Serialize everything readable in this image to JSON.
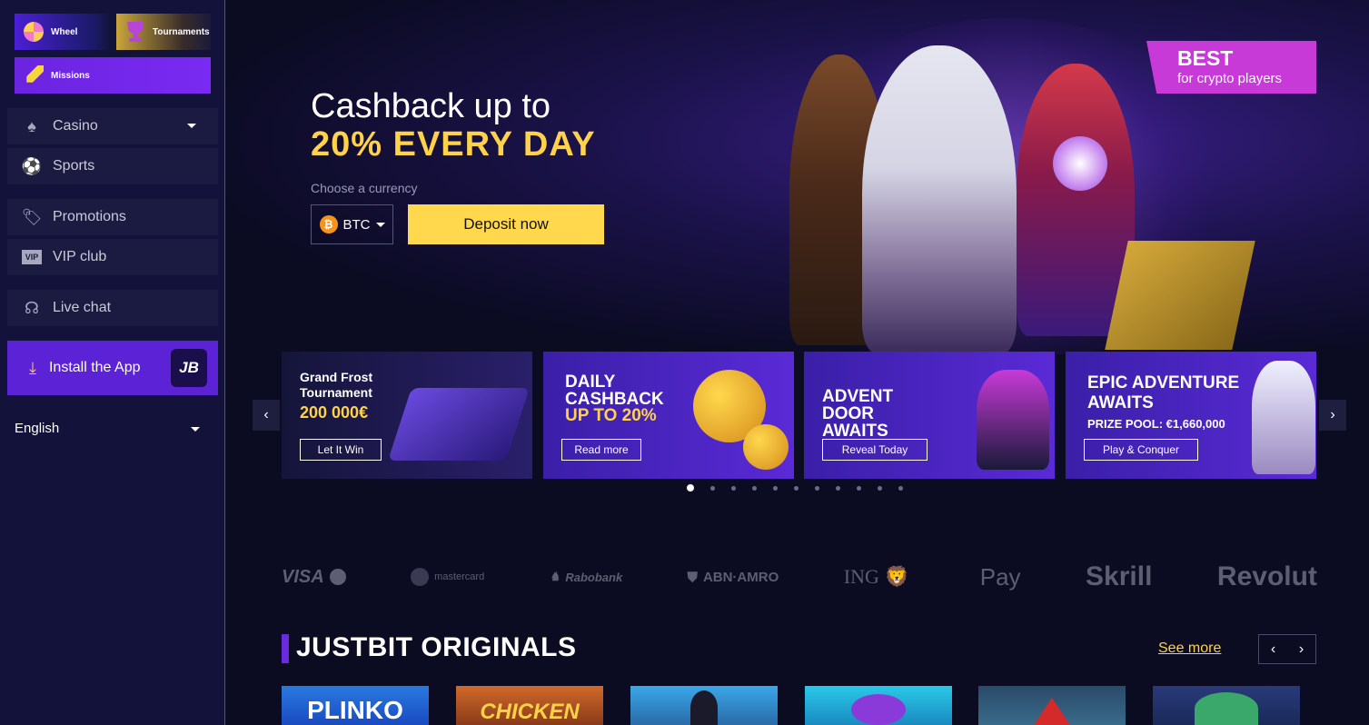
{
  "sidebar": {
    "quick": {
      "wheel": "Wheel",
      "tournaments": "Tournaments",
      "missions": "Missions"
    },
    "nav": {
      "casino": "Casino",
      "sports": "Sports",
      "promotions": "Promotions",
      "vip": "VIP club",
      "livechat": "Live chat"
    },
    "install": "Install the App",
    "install_logo": "JB",
    "language": "English"
  },
  "hero": {
    "line1": "Cashback up to",
    "line2": "20% EVERY DAY",
    "choose": "Choose a currency",
    "currency": "BTC",
    "currency_symbol": "₿",
    "deposit": "Deposit now",
    "badge_title": "BEST",
    "badge_sub": "for crypto players"
  },
  "promos": [
    {
      "title": "Grand Frost Tournament",
      "amount": "200 000€",
      "button": "Let It Win"
    },
    {
      "title": "DAILY CASHBACK",
      "sub": "UP TO 20%",
      "button": "Read more"
    },
    {
      "title": "ADVENT DOOR AWAITS",
      "button": "Reveal Today"
    },
    {
      "title": "EPIC ADVENTURE AWAITS",
      "sub": "PRIZE POOL: €1,660,000",
      "button": "Play & Conquer"
    }
  ],
  "payments": [
    "VISA",
    "mastercard",
    "Rabobank",
    "ABN·AMRO",
    "ING",
    "Pay",
    "Skrill",
    "Revolut"
  ],
  "originals": {
    "title": "JUSTBIT ORIGINALS",
    "see_more": "See more",
    "tiles": [
      "PLINKO",
      "CHICKEN"
    ]
  },
  "colors": {
    "accent_yellow": "#ffd24a",
    "accent_purple": "#5b22d6",
    "background": "#0b0b22"
  }
}
